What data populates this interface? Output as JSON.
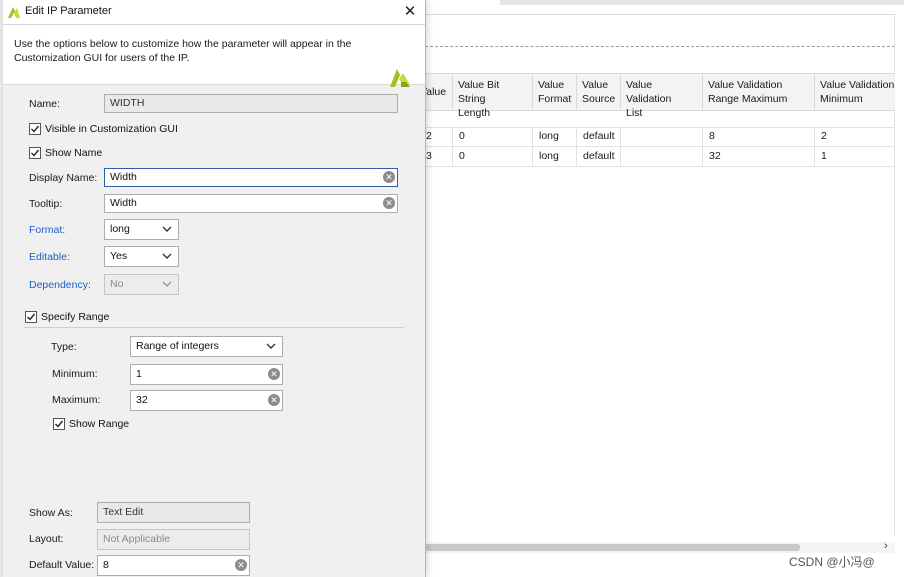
{
  "dialog": {
    "title": "Edit IP Parameter",
    "close_label": "✕",
    "intro": "Use the options below to customize how the parameter will appear in the Customization GUI for users of the IP."
  },
  "form": {
    "name_label": "Name:",
    "name_value": "WIDTH",
    "visible_label": "Visible in Customization GUI",
    "visible_checked": true,
    "show_name_label": "Show Name",
    "show_name_checked": true,
    "display_name_label": "Display Name:",
    "display_name_value": "Width",
    "tooltip_label": "Tooltip:",
    "tooltip_value": "Width",
    "format_label": "Format:",
    "format_value": "long",
    "editable_label": "Editable:",
    "editable_value": "Yes",
    "dependency_label": "Dependency:",
    "dependency_value": "No",
    "specify_range_label": "Specify Range",
    "specify_range_checked": true,
    "type_label": "Type:",
    "type_value": "Range of integers",
    "minimum_label": "Minimum:",
    "minimum_value": "1",
    "maximum_label": "Maximum:",
    "maximum_value": "32",
    "show_range_label": "Show Range",
    "show_range_checked": true,
    "show_as_label": "Show As:",
    "show_as_value": "Text Edit",
    "layout_label": "Layout:",
    "layout_value": "Not Applicable",
    "default_value_label": "Default Value:",
    "default_value_value": "8"
  },
  "table": {
    "headers": [
      "Value",
      "Value Bit String Length",
      "Value Format",
      "Value Source",
      "Value Validation List",
      "Value Validation Range Maximum",
      "Value Validation Range Minimum"
    ],
    "header_lines": [
      [
        "Value",
        ""
      ],
      [
        "Value Bit String",
        "Length"
      ],
      [
        "Value",
        "Format"
      ],
      [
        "Value",
        "Source"
      ],
      [
        "Value Validation",
        "List"
      ],
      [
        "Value Validation",
        "Range Maximum"
      ],
      [
        "Value Validation R",
        "Minimum"
      ]
    ],
    "rows": [
      [
        "2",
        "0",
        "long",
        "default",
        "",
        "8",
        "2"
      ],
      [
        "3",
        "0",
        "long",
        "default",
        "",
        "32",
        "1"
      ]
    ]
  },
  "watermark": "CSDN @小冯@",
  "colors": {
    "link": "#1f5fc4",
    "focus_border": "#2f5eaa",
    "logo": "#9fc21f"
  }
}
